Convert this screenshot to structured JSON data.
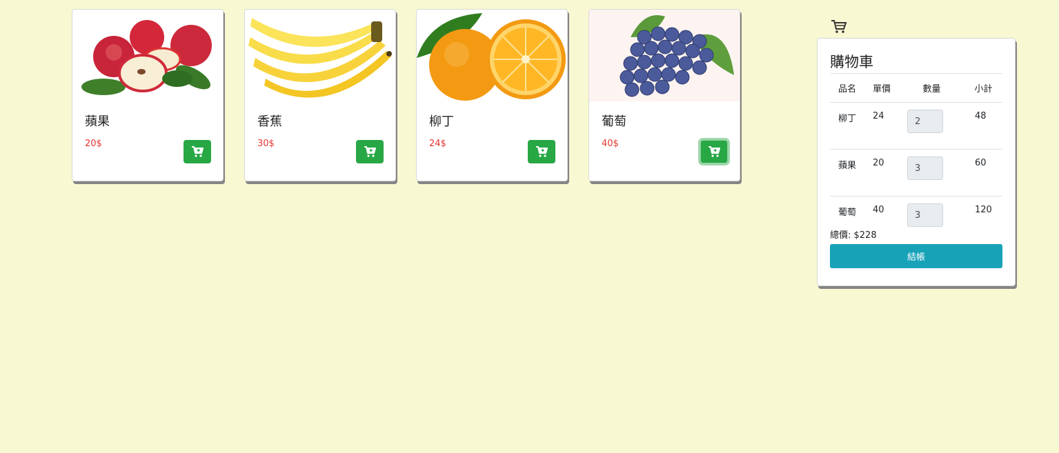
{
  "products": [
    {
      "name": "蘋果",
      "price": "20$",
      "image": "apple-image"
    },
    {
      "name": "香蕉",
      "price": "30$",
      "image": "banana-image"
    },
    {
      "name": "柳丁",
      "price": "24$",
      "image": "orange-image"
    },
    {
      "name": "葡萄",
      "price": "40$",
      "image": "grape-image"
    }
  ],
  "cart": {
    "icon": "cart-icon",
    "title": "購物車",
    "headers": [
      "品名",
      "單價",
      "數量",
      "小計"
    ],
    "items": [
      {
        "name": "柳丁",
        "price": "24",
        "qty": "2",
        "subtotal": "48"
      },
      {
        "name": "蘋果",
        "price": "20",
        "qty": "3",
        "subtotal": "60"
      },
      {
        "name": "葡萄",
        "price": "40",
        "qty": "3",
        "subtotal": "120"
      }
    ],
    "total_label": "總價: $228",
    "checkout_label": "結帳"
  },
  "colors": {
    "background": "#f8f8d2",
    "add_button": "#28a745",
    "checkout_button": "#17a2b8",
    "price_text": "#e3342f"
  }
}
